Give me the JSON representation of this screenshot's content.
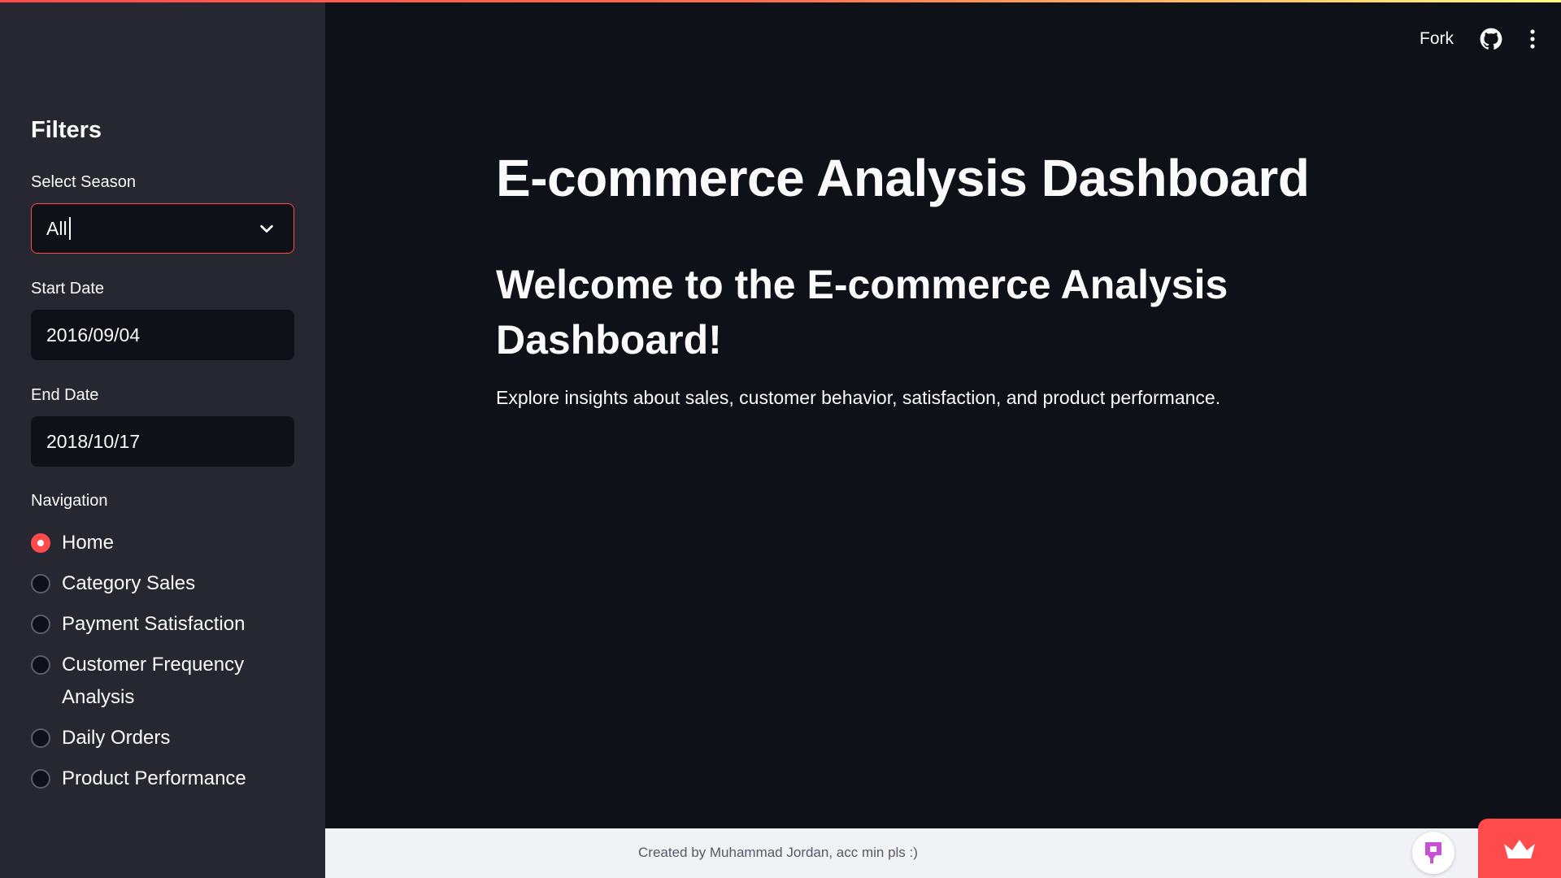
{
  "header": {
    "fork_label": "Fork",
    "github_icon": "github-icon",
    "menu_icon": "kebab-menu-icon"
  },
  "sidebar": {
    "title": "Filters",
    "season": {
      "label": "Select Season",
      "value": "All"
    },
    "start_date": {
      "label": "Start Date",
      "value": "2016/09/04"
    },
    "end_date": {
      "label": "End Date",
      "value": "2018/10/17"
    },
    "navigation": {
      "label": "Navigation",
      "selected": "Home",
      "items": [
        {
          "label": "Home"
        },
        {
          "label": "Category Sales"
        },
        {
          "label": "Payment Satisfaction"
        },
        {
          "label": "Customer Frequency Analysis"
        },
        {
          "label": "Daily Orders"
        },
        {
          "label": "Product Performance"
        }
      ]
    }
  },
  "main": {
    "title": "E-commerce Analysis Dashboard",
    "subtitle": "Welcome to the E-commerce Analysis Dashboard!",
    "description": "Explore insights about sales, customer behavior, satisfaction, and product performance."
  },
  "footer": {
    "text": "Created by Muhammad Jordan, acc min pls :)",
    "badge_icon": "streamlit-badge-icon",
    "manage_icon": "crown-icon"
  },
  "colors": {
    "background": "#0e1117",
    "sidebar": "#262730",
    "accent": "#ff4b4b",
    "footer": "#f0f2f6"
  }
}
